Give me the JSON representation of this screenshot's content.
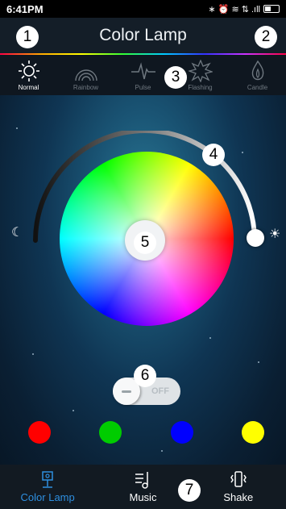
{
  "status_bar": {
    "time": "6:41PM",
    "icons": "∗ ⏰ ≋ ⇅ .ıll"
  },
  "header": {
    "title": "Color Lamp"
  },
  "modes": [
    {
      "label": "Normal",
      "icon": "sun-icon",
      "active": true
    },
    {
      "label": "Rainbow",
      "icon": "rainbow-icon",
      "active": false
    },
    {
      "label": "Pulse",
      "icon": "pulse-icon",
      "active": false
    },
    {
      "label": "Flashing",
      "icon": "flashing-icon",
      "active": false
    },
    {
      "label": "Candle",
      "icon": "candle-icon",
      "active": false
    }
  ],
  "brightness": {
    "low_icon": "moon-icon",
    "high_icon": "sun-icon",
    "low_glyph": "☾",
    "high_glyph": "☀"
  },
  "power_toggle": {
    "state_label": "OFF"
  },
  "preset_colors": [
    "#ff0000",
    "#00cc00",
    "#0000ff",
    "#ffff00"
  ],
  "tabs": [
    {
      "label": "Color Lamp",
      "icon": "lamp-icon",
      "active": true
    },
    {
      "label": "Music",
      "icon": "music-icon",
      "active": false
    },
    {
      "label": "Shake",
      "icon": "shake-icon",
      "active": false
    }
  ],
  "annotations": [
    "1",
    "2",
    "3",
    "4",
    "5",
    "6",
    "7"
  ],
  "colors": {
    "accent": "#2e8fe0",
    "header_bg": "#141e28"
  }
}
